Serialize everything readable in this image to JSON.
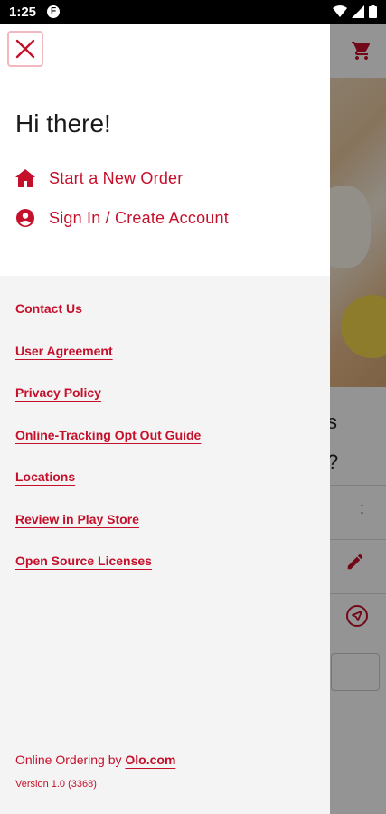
{
  "status_bar": {
    "time": "1:25",
    "app_icon": "F",
    "icons": [
      "wifi-icon",
      "signal-icon",
      "battery-icon"
    ]
  },
  "background_app": {
    "text_fragment_1": "s",
    "text_fragment_2": "?",
    "overflow": ":",
    "icons": [
      "cart-icon",
      "pencil-icon",
      "navigation-icon"
    ]
  },
  "drawer": {
    "close_icon": "close-icon",
    "greeting": "Hi there!",
    "menu": [
      {
        "label": "Start a New Order",
        "icon": "home-icon"
      },
      {
        "label": "Sign In / Create Account",
        "icon": "account-icon"
      }
    ],
    "links": [
      "Contact Us",
      "User Agreement",
      "Privacy Policy",
      "Online-Tracking Opt Out Guide",
      "Locations",
      "Review in Play Store",
      "Open Source Licenses"
    ],
    "footer": {
      "prefix": "Online Ordering by ",
      "link": "Olo.com",
      "version": "Version 1.0 (3368)"
    }
  },
  "colors": {
    "accent": "#c5102b",
    "drawer_background": "#f4f4f4",
    "close_border": "#f1b9bf"
  }
}
